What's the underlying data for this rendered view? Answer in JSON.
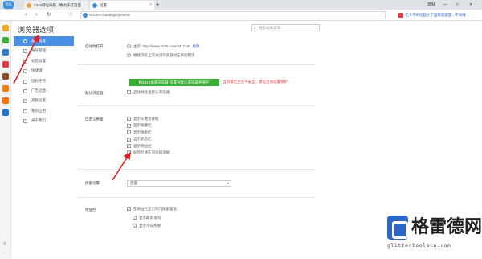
{
  "tabs": [
    {
      "title": "2345网址导航 - 致力于打造百",
      "active": false
    },
    {
      "title": "设置",
      "active": true
    }
  ],
  "browser_logo_label": "登录",
  "window": {
    "user": "皮肤",
    "min": "—",
    "max": "□",
    "close": "✕"
  },
  "toolbar": {
    "back": "‹",
    "forward": "›",
    "reload": "↻",
    "star": "☆",
    "url": "chrome://settings/general"
  },
  "news": "老人不听问题大了国家家庭医...不早睡",
  "page_title": "浏览器选项",
  "search_placeholder": "搜索相关选项",
  "nav": [
    {
      "label": "基本设置",
      "active": true
    },
    {
      "label": "账号管理",
      "active": false
    },
    {
      "label": "标签设置",
      "active": false
    },
    {
      "label": "快捷键",
      "active": false
    },
    {
      "label": "鼠标手势",
      "active": false
    },
    {
      "label": "广告过滤",
      "active": false
    },
    {
      "label": "高级设置",
      "active": false
    },
    {
      "label": "我的应用",
      "active": false
    },
    {
      "label": "关于我们",
      "active": false
    }
  ],
  "startup": {
    "label": "启动时打开",
    "homepage_text": "主页: http://www.2345.com/?41019",
    "change_link": "更改",
    "restore_text": "继续浏览上次关闭浏览器时在看的网页"
  },
  "default_browser": {
    "label": "默认浏览器",
    "button": "将2345加速浏览器 设置为默认浏览器并保护",
    "warning": "当前锁定主页不安全，建议主动设置保护",
    "check_text": "启动时检查默认浏览器"
  },
  "custom_ui": {
    "label": "自定义界面",
    "options": [
      {
        "text": "显示头像登录框",
        "checked": true
      },
      {
        "text": "显示收藏栏",
        "checked": false
      },
      {
        "text": "显示搜索栏",
        "checked": true
      },
      {
        "text": "显示状态栏",
        "checked": true
      },
      {
        "text": "显示侧边栏",
        "checked": true
      },
      {
        "text": "标签栏放在浏览器顶部",
        "checked": false
      }
    ]
  },
  "search_engine": {
    "label": "搜索引擎",
    "value": "百度",
    "arrow": "▾"
  },
  "address_bar": {
    "label": "地址栏",
    "options": [
      {
        "text": "在地址栏显示热门搜索面板",
        "checked": true
      },
      {
        "text": "显示最常访问",
        "checked": true
      },
      {
        "text": "显示今日热搜",
        "checked": true
      }
    ]
  },
  "watermark": {
    "brand": "格雷德网",
    "url": "glittertoolscn.com"
  },
  "colors": {
    "accent": "#4a90e2",
    "green": "#3cb034",
    "warning": "#e4393c",
    "annotation": "#e02020"
  }
}
